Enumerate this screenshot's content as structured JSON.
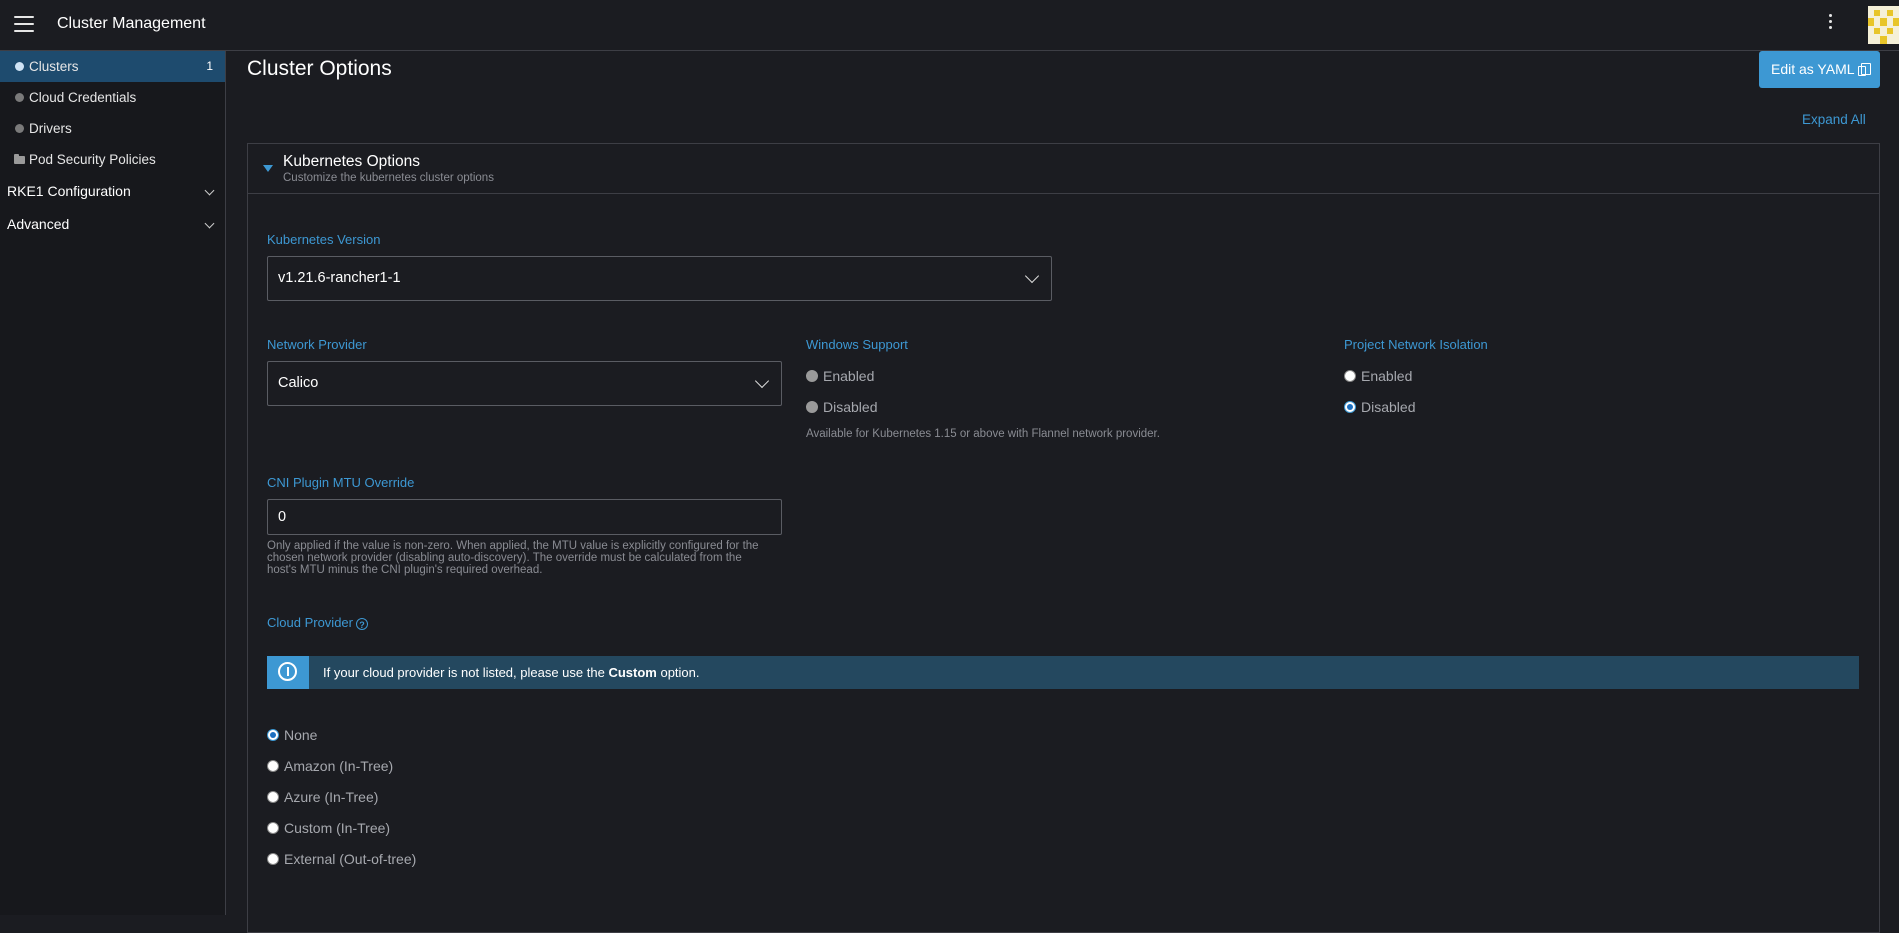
{
  "header": {
    "title": "Cluster Management"
  },
  "sidebar": {
    "items": [
      {
        "label": "Clusters",
        "count": "1"
      },
      {
        "label": "Cloud Credentials"
      },
      {
        "label": "Drivers"
      },
      {
        "label": "Pod Security Policies"
      }
    ],
    "groups": [
      {
        "label": "RKE1 Configuration"
      },
      {
        "label": "Advanced"
      }
    ]
  },
  "main": {
    "title": "Cluster Options",
    "edit_yaml_label": "Edit as YAML",
    "expand_all_label": "Expand All",
    "section": {
      "title": "Kubernetes Options",
      "subtitle": "Customize the kubernetes cluster options"
    },
    "k8s_version": {
      "label": "Kubernetes Version",
      "value": "v1.21.6-rancher1-1"
    },
    "network_provider": {
      "label": "Network Provider",
      "value": "Calico"
    },
    "windows_support": {
      "label": "Windows Support",
      "options": [
        "Enabled",
        "Disabled"
      ],
      "help": "Available for Kubernetes 1.15 or above with Flannel network provider."
    },
    "project_isolation": {
      "label": "Project Network Isolation",
      "options": [
        "Enabled",
        "Disabled"
      ],
      "selected": "Disabled"
    },
    "cni_mtu": {
      "label": "CNI Plugin MTU Override",
      "value": "0",
      "help_lines": [
        "Only applied if the value is non-zero. When applied, the MTU value is explicitly configured for the",
        "chosen network provider (disabling auto-discovery). The override must be calculated from the",
        "host's MTU minus the CNI plugin's required overhead."
      ]
    },
    "cloud_provider": {
      "label": "Cloud Provider",
      "help_icon": "?",
      "banner_prefix": "If your cloud provider is not listed, please use the",
      "banner_bold": "Custom",
      "banner_suffix": "option.",
      "options": [
        "None",
        "Amazon (In-Tree)",
        "Azure (In-Tree)",
        "Custom (In-Tree)",
        "External (Out-of-tree)"
      ],
      "selected": "None"
    }
  }
}
